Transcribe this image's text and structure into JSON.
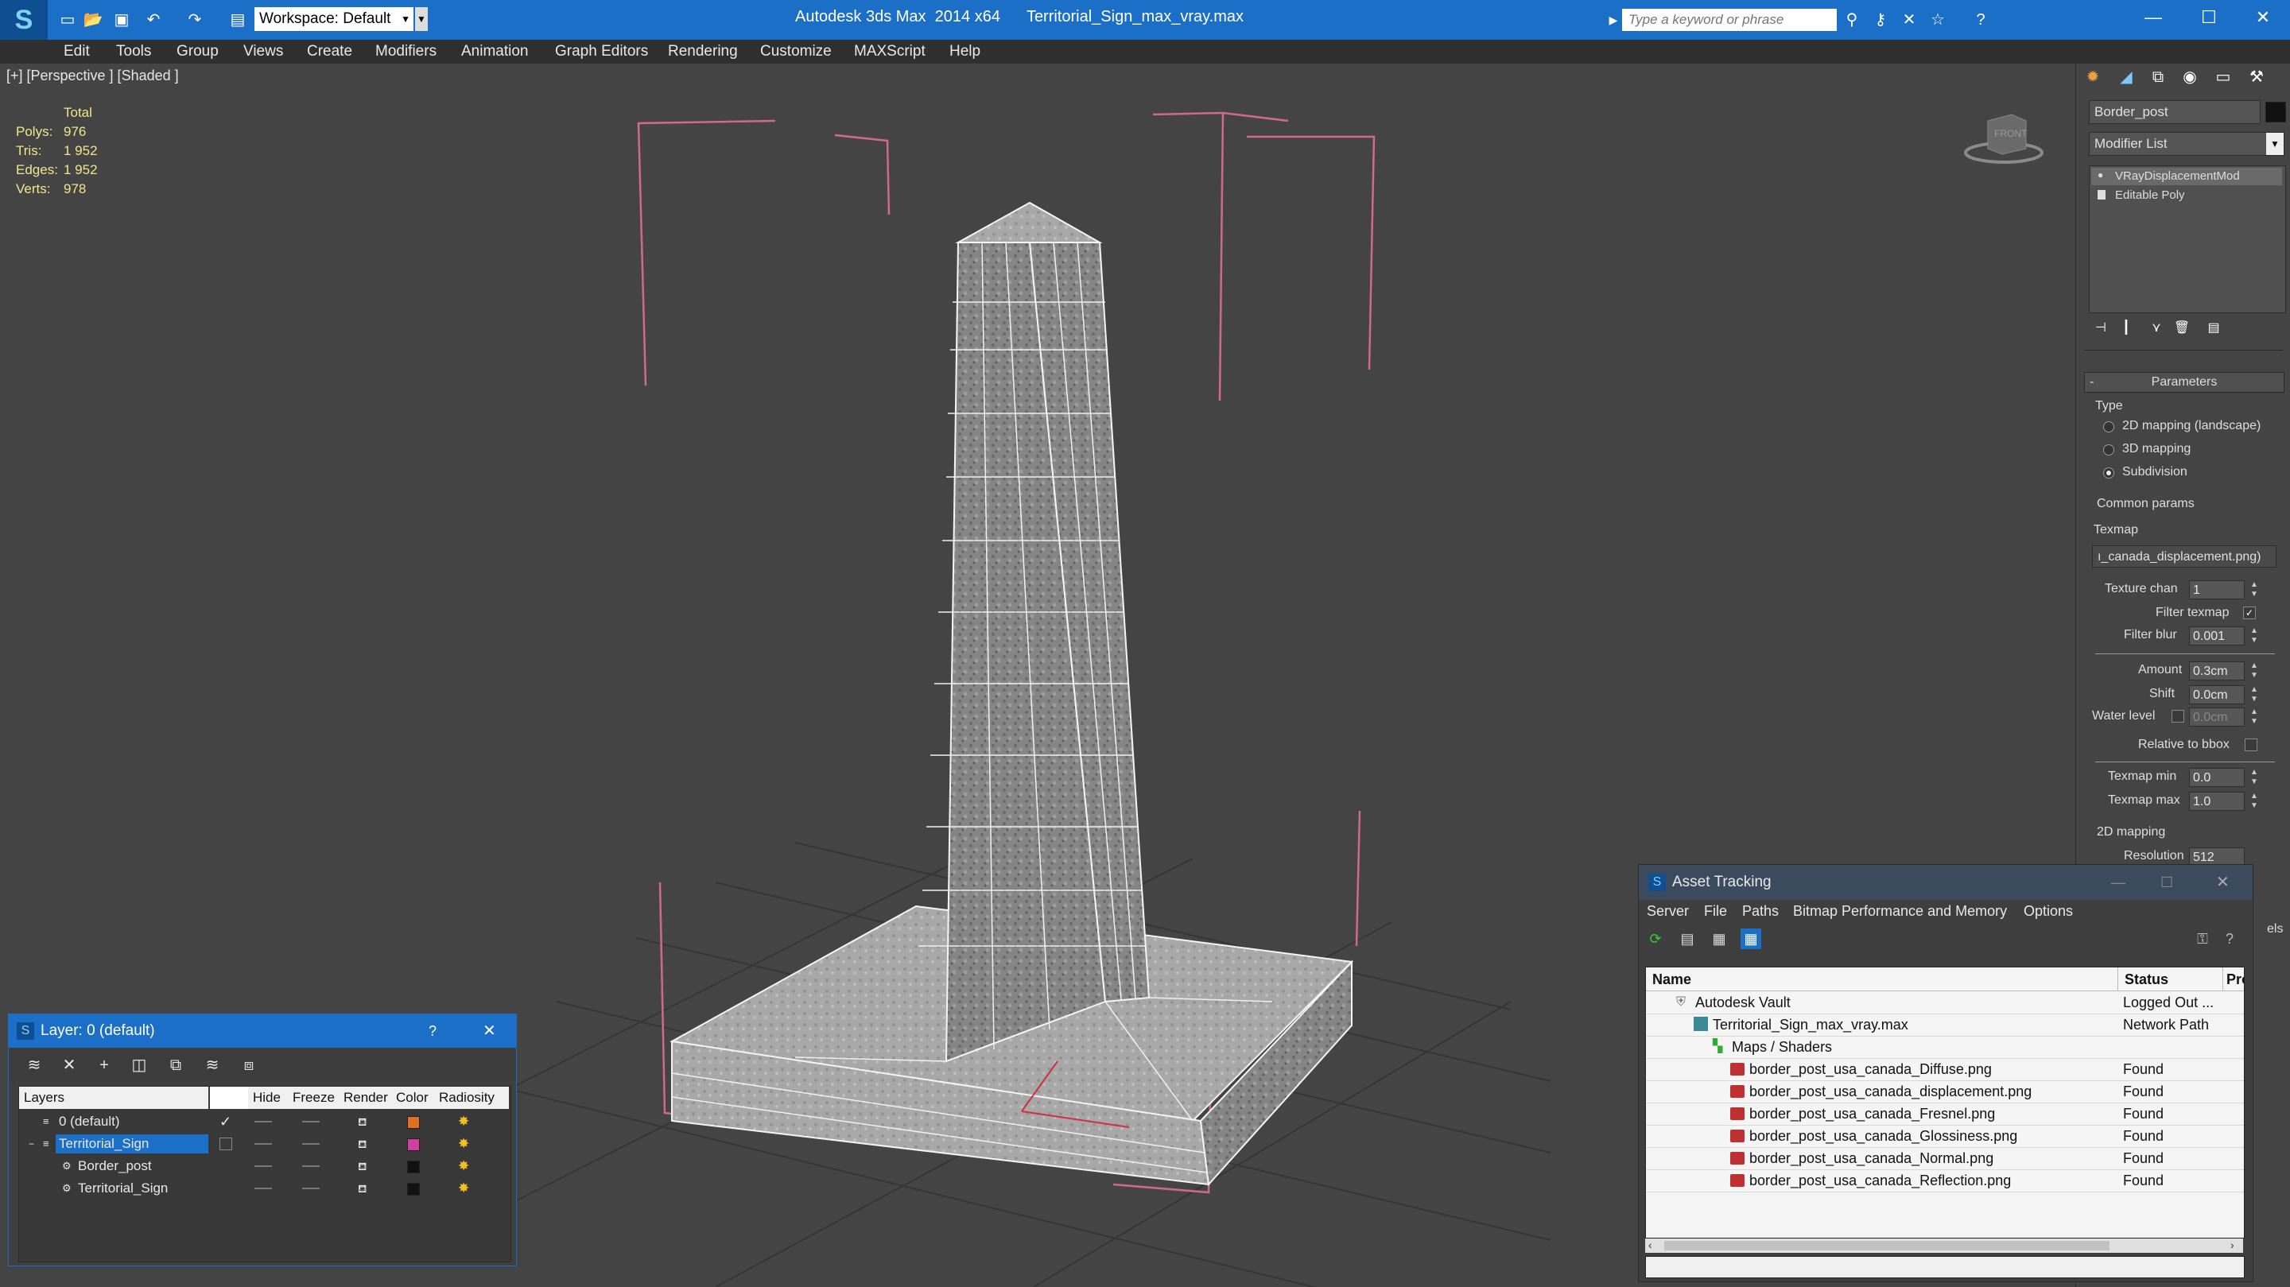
{
  "titlebar": {
    "app_title": "Autodesk 3ds Max  2014 x64",
    "file_title": "Territorial_Sign_max_vray.max",
    "workspace_label": "Workspace: Default",
    "search_placeholder": "Type a keyword or phrase",
    "accent_color": "#1c6fc6"
  },
  "menu": [
    "Edit",
    "Tools",
    "Group",
    "Views",
    "Create",
    "Modifiers",
    "Animation",
    "Graph Editors",
    "Rendering",
    "Customize",
    "MAXScript",
    "Help"
  ],
  "viewport": {
    "label": "[+] [Perspective ] [Shaded ]",
    "stats": {
      "total_label": "Total",
      "rows": [
        {
          "label": "Polys:",
          "value": "976"
        },
        {
          "label": "Tris:",
          "value": "1 952"
        },
        {
          "label": "Edges:",
          "value": "1 952"
        },
        {
          "label": "Verts:",
          "value": "978"
        }
      ]
    },
    "navcube_label": "FRONT"
  },
  "command_panel": {
    "object_name": "Border_post",
    "modifier_list_label": "Modifier List",
    "stack": [
      "VRayDisplacementMod",
      "Editable Poly"
    ],
    "rollout_title": "Parameters",
    "type_label": "Type",
    "type_options": [
      {
        "label": "2D mapping (landscape)",
        "selected": false
      },
      {
        "label": "3D mapping",
        "selected": false
      },
      {
        "label": "Subdivision",
        "selected": true
      }
    ],
    "common_params_label": "Common params",
    "texmap_label": "Texmap",
    "texmap_value": "ı_canada_displacement.png)",
    "texture_chan_label": "Texture chan",
    "texture_chan_value": "1",
    "filter_texmap_label": "Filter texmap",
    "filter_texmap_checked": true,
    "filter_blur_label": "Filter blur",
    "filter_blur_value": "0.001",
    "amount_label": "Amount",
    "amount_value": "0.3cm",
    "shift_label": "Shift",
    "shift_value": "0.0cm",
    "water_level_label": "Water level",
    "water_level_value": "0.0cm",
    "relative_bbox_label": "Relative to bbox",
    "texmap_min_label": "Texmap min",
    "texmap_min_value": "0.0",
    "texmap_max_label": "Texmap max",
    "texmap_max_value": "1.0",
    "mapping2d_label": "2D mapping",
    "resolution_label": "Resolution",
    "resolution_value": "512",
    "clipped_label": "els"
  },
  "layer_window": {
    "title": "Layer: 0 (default)",
    "help": "?",
    "columns": [
      "Layers",
      "Hide",
      "Freeze",
      "Render",
      "Color",
      "Radiosity"
    ],
    "rows": [
      {
        "name": "0 (default)",
        "color": "#e07020",
        "current": true,
        "selected": false,
        "indent": 0
      },
      {
        "name": "Territorial_Sign",
        "color": "#d040a0",
        "current": false,
        "selected": true,
        "indent": 0
      },
      {
        "name": "Border_post",
        "color": "#111111",
        "current": false,
        "selected": false,
        "indent": 1
      },
      {
        "name": "Territorial_Sign",
        "color": "#111111",
        "current": false,
        "selected": false,
        "indent": 1
      }
    ]
  },
  "asset_window": {
    "title": "Asset Tracking",
    "menu": [
      "Server",
      "File",
      "Paths",
      "Bitmap Performance and Memory",
      "Options"
    ],
    "columns": [
      "Name",
      "Status",
      "Prox"
    ],
    "rows": [
      {
        "name": "Autodesk Vault",
        "status": "Logged Out ...",
        "indent": 1,
        "icon": "vault"
      },
      {
        "name": "Territorial_Sign_max_vray.max",
        "status": "Network Path",
        "indent": 2,
        "icon": "max"
      },
      {
        "name": "Maps / Shaders",
        "status": "",
        "indent": 3,
        "icon": "maps"
      },
      {
        "name": "border_post_usa_canada_Diffuse.png",
        "status": "Found",
        "indent": 4,
        "icon": "png"
      },
      {
        "name": "border_post_usa_canada_displacement.png",
        "status": "Found",
        "indent": 4,
        "icon": "png"
      },
      {
        "name": "border_post_usa_canada_Fresnel.png",
        "status": "Found",
        "indent": 4,
        "icon": "png"
      },
      {
        "name": "border_post_usa_canada_Glossiness.png",
        "status": "Found",
        "indent": 4,
        "icon": "png"
      },
      {
        "name": "border_post_usa_canada_Normal.png",
        "status": "Found",
        "indent": 4,
        "icon": "png"
      },
      {
        "name": "border_post_usa_canada_Reflection.png",
        "status": "Found",
        "indent": 4,
        "icon": "png"
      }
    ]
  }
}
